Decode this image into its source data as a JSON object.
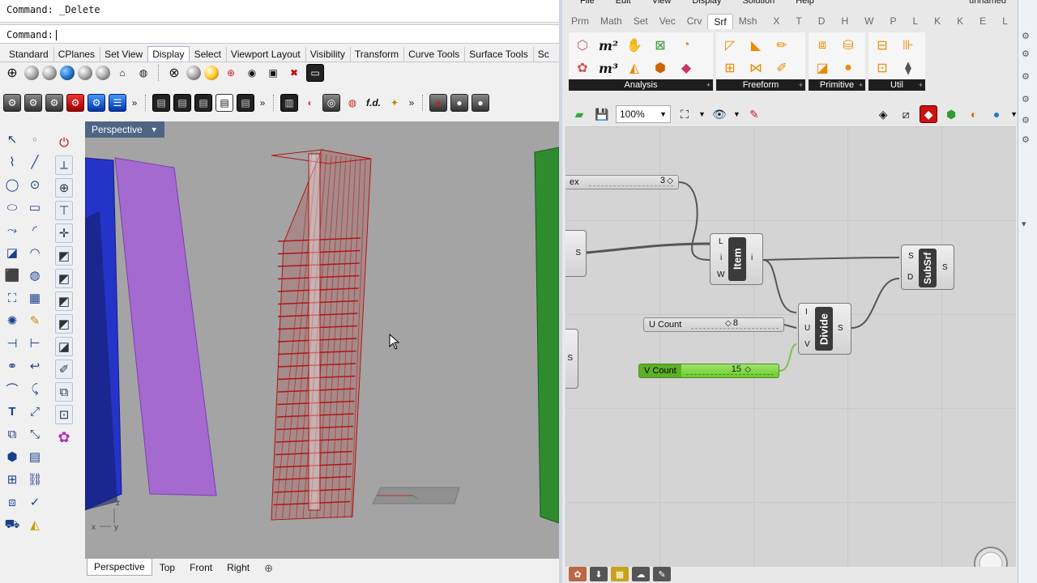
{
  "rhino": {
    "command_history": "Command: _Delete",
    "command_prompt": "Command:",
    "toolbar_tabs": [
      "Standard",
      "CPlanes",
      "Set View",
      "Display",
      "Select",
      "Viewport Layout",
      "Visibility",
      "Transform",
      "Curve Tools",
      "Surface Tools",
      "Sc"
    ],
    "active_tab": "Display",
    "viewport_title": "Perspective",
    "viewport_tabs": [
      "Perspective",
      "Top",
      "Front",
      "Right"
    ],
    "active_viewport_tab": "Perspective",
    "add_tab_glyph": "⊕",
    "axis_labels": {
      "z": "z",
      "x": "x",
      "y": "y"
    },
    "more_glyph": "»"
  },
  "grasshopper": {
    "window_title": "unnamed",
    "menu": [
      "File",
      "Edit",
      "View",
      "Display",
      "Solution",
      "Help"
    ],
    "tabs": [
      "Prm",
      "Math",
      "Set",
      "Vec",
      "Crv",
      "Srf",
      "Msh",
      "X",
      "T",
      "D",
      "H",
      "W",
      "P",
      "L",
      "K",
      "K",
      "E",
      "L"
    ],
    "active_tab": "Srf",
    "ribbon_groups": [
      "Analysis",
      "Freeform",
      "Primitive",
      "Util"
    ],
    "zoom": "100%",
    "canvas": {
      "slider_index": {
        "label": "ex",
        "value": "3"
      },
      "slider_u": {
        "label": "U Count",
        "value": "8"
      },
      "slider_v": {
        "label": "V Count",
        "value": "15"
      },
      "item": {
        "title": "Item",
        "inputs": [
          "L",
          "i",
          "W"
        ],
        "output": "i"
      },
      "divide": {
        "title": "Divide",
        "inputs": [
          "I",
          "U",
          "V"
        ],
        "output": "S"
      },
      "subsrf": {
        "title": "SubSrf",
        "inputs": [
          "S",
          "D"
        ],
        "output": "S"
      },
      "left_stub_a": "S",
      "left_stub_b": "S"
    }
  },
  "colors": {
    "viewport_bg": "#a4a4a4",
    "tower_red": "#b01515",
    "panel_purple": "#a46ad0",
    "panel_blue": "#2434c8",
    "panel_green": "#2e8c2e",
    "slider_green": "#6ccb2e"
  }
}
